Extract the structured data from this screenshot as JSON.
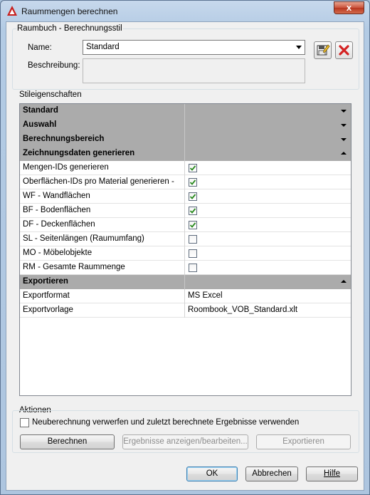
{
  "window": {
    "title": "Raummengen berechnen",
    "close_label": "x"
  },
  "raumbuch": {
    "group_label": "Raumbuch - Berechnungsstil",
    "name_label": "Name:",
    "name_value": "Standard",
    "description_label": "Beschreibung:",
    "description_value": ""
  },
  "stil": {
    "group_label": "Stileigenschaften",
    "rows": [
      {
        "kind": "category",
        "label": "Standard",
        "expanded": false
      },
      {
        "kind": "category",
        "label": "Auswahl",
        "expanded": false
      },
      {
        "kind": "category",
        "label": "Berechnungsbereich",
        "expanded": false
      },
      {
        "kind": "category",
        "label": "Zeichnungsdaten generieren",
        "expanded": true
      },
      {
        "kind": "check",
        "label": "Mengen-IDs generieren",
        "checked": true
      },
      {
        "kind": "check",
        "label": "Oberflächen-IDs pro Material generieren -",
        "checked": true
      },
      {
        "kind": "check",
        "label": "WF - Wandflächen",
        "checked": true
      },
      {
        "kind": "check",
        "label": "BF - Bodenflächen",
        "checked": true
      },
      {
        "kind": "check",
        "label": "DF - Deckenflächen",
        "checked": true
      },
      {
        "kind": "check",
        "label": "SL - Seitenlängen (Raumumfang)",
        "checked": false
      },
      {
        "kind": "check",
        "label": "MO - Möbelobjekte",
        "checked": false
      },
      {
        "kind": "check",
        "label": "RM - Gesamte Raummenge",
        "checked": false
      },
      {
        "kind": "category",
        "label": "Exportieren",
        "expanded": true
      },
      {
        "kind": "text",
        "label": "Exportformat",
        "value": "MS Excel"
      },
      {
        "kind": "text",
        "label": "Exportvorlage",
        "value": "Roombook_VOB_Standard.xlt"
      }
    ]
  },
  "aktionen": {
    "group_label": "Aktionen",
    "discard_label": "Neuberechnung verwerfen und zuletzt berechnete Ergebnisse verwenden",
    "discard_checked": false,
    "berechnen_label": "Berechnen",
    "ergebnisse_label": "Ergebnisse anzeigen/bearbeiten...",
    "exportieren_label": "Exportieren"
  },
  "footer": {
    "ok_label": "OK",
    "cancel_label": "Abbrechen",
    "help_label": "Hilfe"
  },
  "colors": {
    "category_bg": "#ababab",
    "check_green": "#2a8a1f",
    "delete_red": "#d42222"
  }
}
